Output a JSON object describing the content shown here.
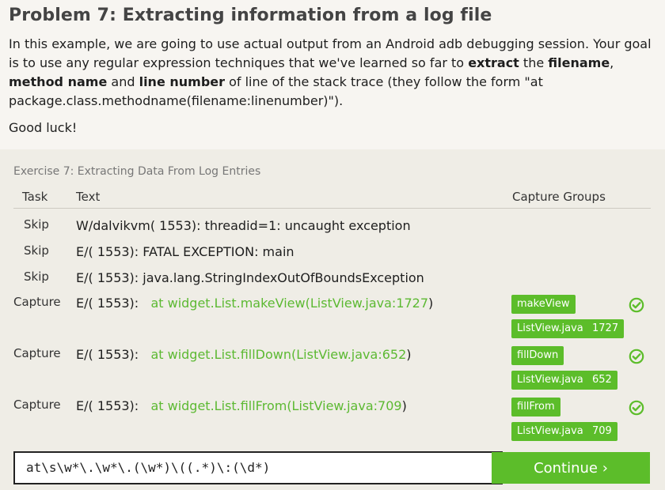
{
  "header": {
    "title": "Problem 7: Extracting information from a log file",
    "intro_1": "In this example, we are going to use actual output from an Android adb debugging session. Your goal is to use any regular expression techniques that we've learned so far to ",
    "bold_extract": "extract",
    "intro_2": " the ",
    "bold_filename": "filename",
    "intro_3": ", ",
    "bold_method": "method name",
    "intro_4": " and ",
    "bold_line": "line number",
    "intro_5": " of line of the stack trace (they follow the form \"at package.class.methodname(filename:linenumber)\").",
    "good_luck": "Good luck!"
  },
  "exercise": {
    "title": "Exercise 7: Extracting Data From Log Entries",
    "columns": {
      "task": "Task",
      "text": "Text",
      "capture": "Capture Groups"
    },
    "rows": [
      {
        "task": "Skip",
        "text": "W/dalvikvm( 1553): threadid=1: uncaught exception"
      },
      {
        "task": "Skip",
        "text": "E/( 1553): FATAL EXCEPTION: main"
      },
      {
        "task": "Skip",
        "text": "E/( 1553): java.lang.StringIndexOutOfBoundsException"
      },
      {
        "task": "Capture",
        "prefix": "E/( 1553):   ",
        "match": "at widget.List.makeView(ListView.java:1727",
        "suffix": ")",
        "groups": [
          "makeView",
          "ListView.java",
          "1727"
        ]
      },
      {
        "task": "Capture",
        "prefix": "E/( 1553):   ",
        "match": "at widget.List.fillDown(ListView.java:652",
        "suffix": ")",
        "groups": [
          "fillDown",
          "ListView.java",
          "652"
        ]
      },
      {
        "task": "Capture",
        "prefix": "E/( 1553):   ",
        "match": "at widget.List.fillFrom(ListView.java:709",
        "suffix": ")",
        "groups": [
          "fillFrom",
          "ListView.java",
          "709"
        ]
      }
    ],
    "input_value": "at\\s\\w*\\.\\w*\\.(\\w*)\\((.*)\\:(\\d*)",
    "continue_label": "Continue ›"
  },
  "colors": {
    "accent": "#5cbd2a",
    "match_text": "#5cb932",
    "panel": "#efede6"
  },
  "icons": {
    "success": "check-circle-icon"
  }
}
